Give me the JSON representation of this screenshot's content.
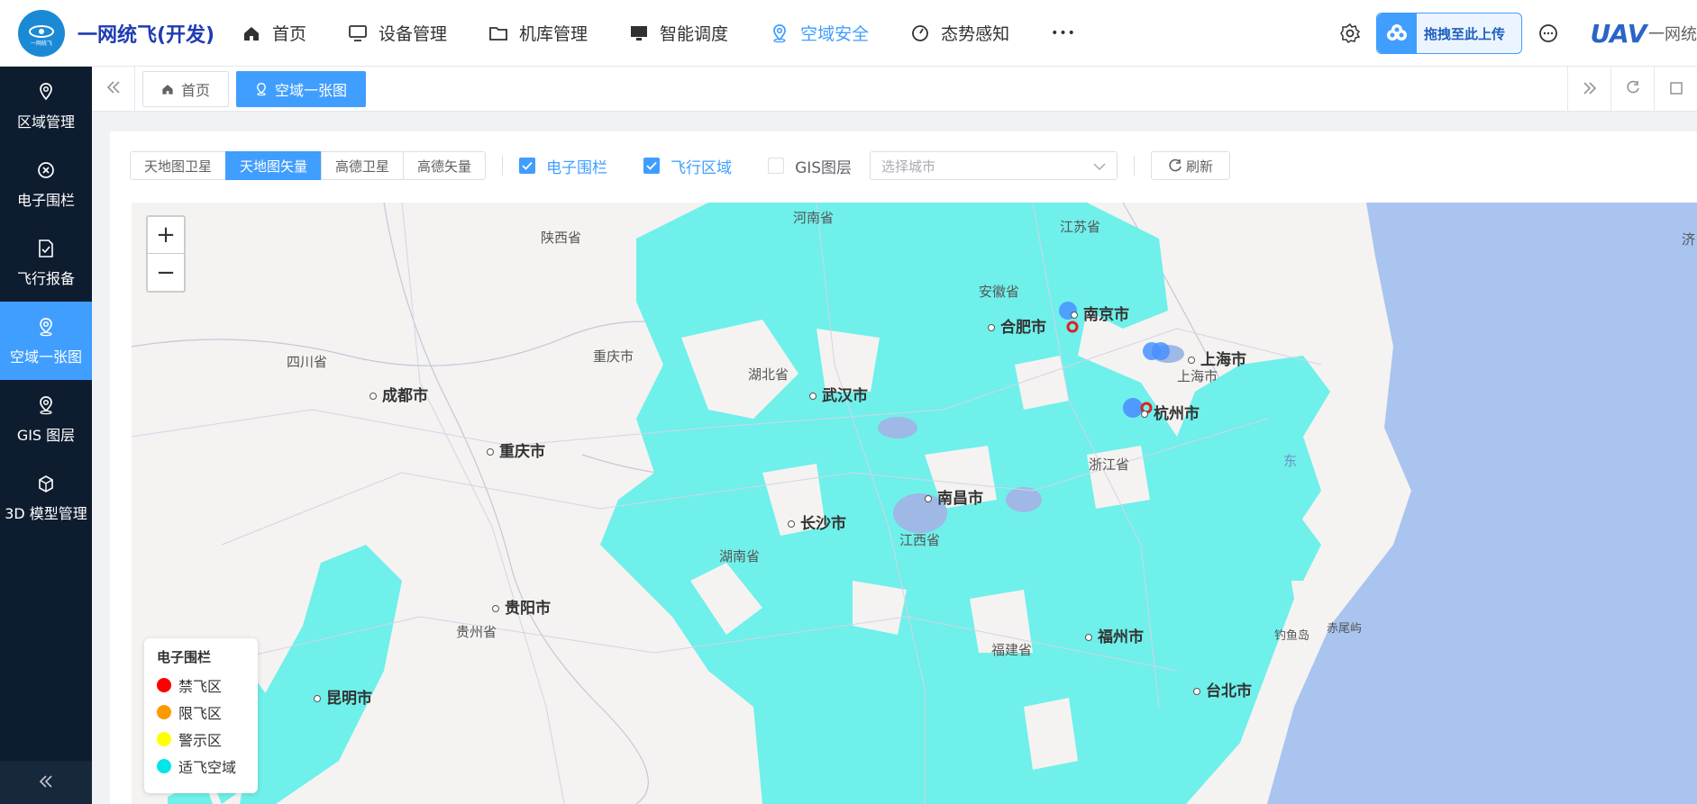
{
  "header": {
    "logo_text": "一网统飞",
    "app_title": "一网统飞(开发)",
    "nav": [
      {
        "label": "首页",
        "icon": "home-icon"
      },
      {
        "label": "设备管理",
        "icon": "monitor-icon"
      },
      {
        "label": "机库管理",
        "icon": "folder-icon"
      },
      {
        "label": "智能调度",
        "icon": "screen-icon"
      },
      {
        "label": "空域安全",
        "icon": "location-icon",
        "active": true
      },
      {
        "label": "态势感知",
        "icon": "gauge-icon"
      },
      {
        "label": "•••",
        "icon": "more-icon"
      }
    ],
    "upload_label": "拖拽至此上传",
    "user_avatar": "UAV",
    "user_name": "一网统"
  },
  "sidebar": {
    "items": [
      {
        "label": "区域管理",
        "icon": "pin-icon"
      },
      {
        "label": "电子围栏",
        "icon": "close-circle-icon"
      },
      {
        "label": "飞行报备",
        "icon": "document-check-icon"
      },
      {
        "label": "空域一张图",
        "icon": "location-user-icon",
        "active": true
      },
      {
        "label": "GIS 图层",
        "icon": "location-user-icon"
      },
      {
        "label": "3D 模型管理",
        "icon": "box-icon"
      }
    ]
  },
  "tabs": {
    "items": [
      {
        "label": "首页",
        "icon": "home-icon"
      },
      {
        "label": "空域一张图",
        "icon": "location-user-icon",
        "active": true
      }
    ]
  },
  "toolbar": {
    "map_types": [
      "天地图卫星",
      "天地图矢量",
      "高德卫星",
      "高德矢量"
    ],
    "active_map_type": "天地图矢量",
    "checkboxes": [
      {
        "label": "电子围栏",
        "checked": true
      },
      {
        "label": "飞行区域",
        "checked": true
      },
      {
        "label": "GIS图层",
        "checked": false
      }
    ],
    "city_placeholder": "选择城市",
    "refresh_label": "刷新"
  },
  "map": {
    "zoom_in": "+",
    "zoom_out": "−",
    "labels": {
      "henan": "河南省",
      "shaanxi": "陕西省",
      "jiangsu": "江苏省",
      "anhui": "安徽省",
      "sichuan": "四川省",
      "chongqing_prov": "重庆市",
      "hubei": "湖北省",
      "shanghai_prov": "上海市",
      "zhejiang": "浙江省",
      "jiangxi": "江西省",
      "hunan": "湖南省",
      "guizhou": "贵州省",
      "fujian": "福建省",
      "nanjing": "南京市",
      "hefei": "合肥市",
      "shanghai": "上海市",
      "chengdu": "成都市",
      "wuhan": "武汉市",
      "hangzhou": "杭州市",
      "chongqing": "重庆市",
      "nanchang": "南昌市",
      "changsha": "长沙市",
      "guiyang": "贵阳市",
      "fuzhou": "福州市",
      "kunming": "昆明市",
      "taipei": "台北市",
      "diaoyu": "钓鱼岛",
      "chiwei": "赤尾屿",
      "east": "东",
      "edge": "济"
    },
    "legend": {
      "title": "电子围栏",
      "items": [
        {
          "label": "禁飞区",
          "color": "#ff0000"
        },
        {
          "label": "限飞区",
          "color": "#ff9900"
        },
        {
          "label": "警示区",
          "color": "#ffff00"
        },
        {
          "label": "适飞空域",
          "color": "#00e5e5"
        }
      ]
    }
  },
  "colors": {
    "accent": "#409eff",
    "sidebar_bg": "#0e1c2f",
    "fly_zone": "#6ff0ea",
    "sea": "#a8c4ef"
  }
}
